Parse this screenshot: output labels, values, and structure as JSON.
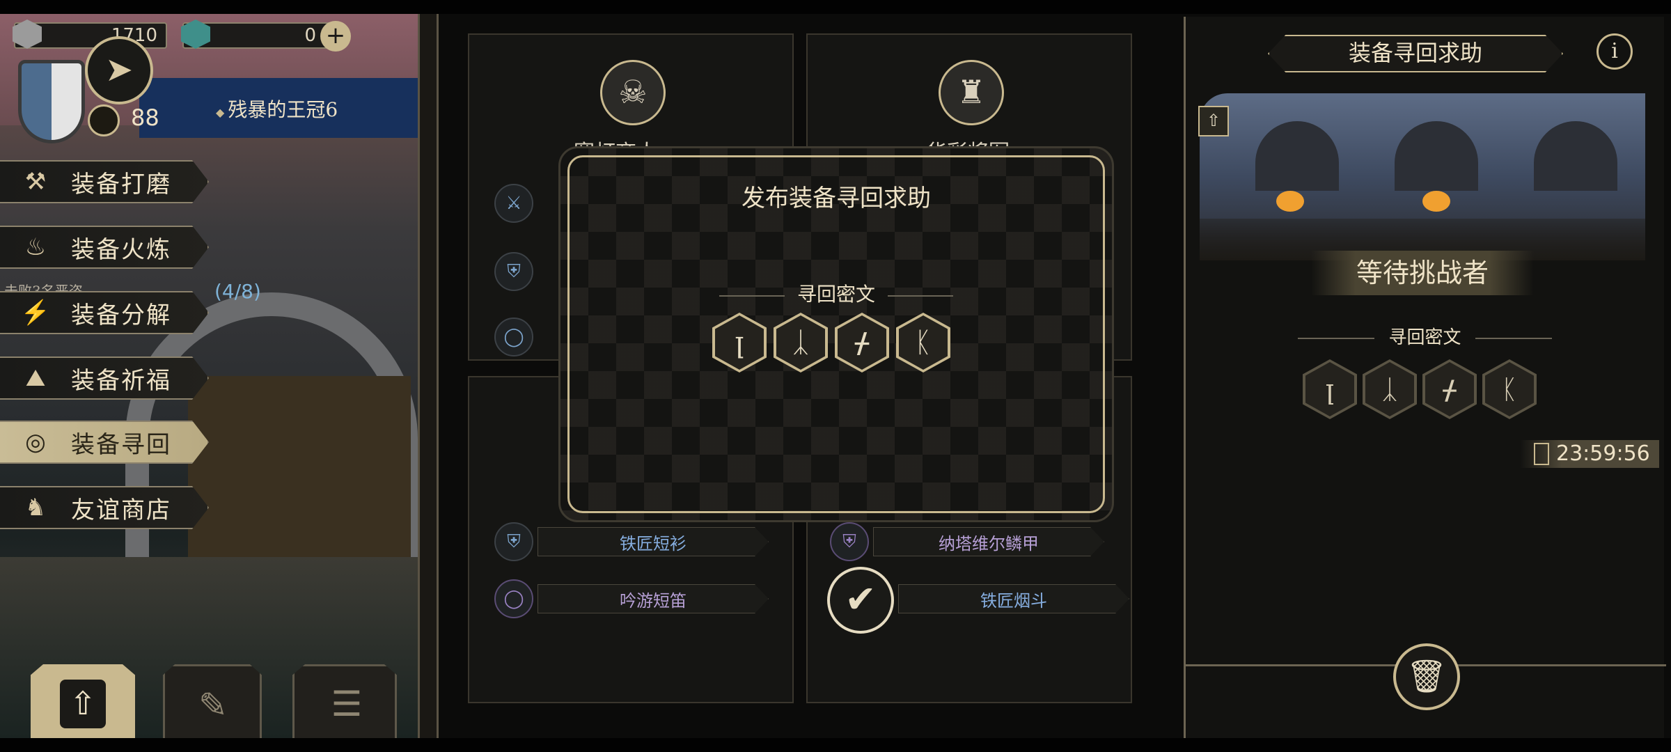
{
  "hud": {
    "resource1_value": "1710",
    "resource2_value": "0",
    "player_level": "88",
    "location_title": "残暴的王冠6",
    "quest_progress": "(4/8)",
    "quest_text": "击败3名恶盗"
  },
  "sidebar": {
    "items": [
      {
        "label": "装备打磨",
        "icon": "hammer-icon"
      },
      {
        "label": "装备火炼",
        "icon": "flame-icon"
      },
      {
        "label": "装备分解",
        "icon": "disassemble-icon"
      },
      {
        "label": "装备祈福",
        "icon": "pray-hands-icon"
      },
      {
        "label": "装备寻回",
        "icon": "target-icon",
        "active": true
      },
      {
        "label": "友谊商店",
        "icon": "fox-icon"
      }
    ]
  },
  "cards": {
    "card1_name": "寒灯商人",
    "card2_name": "华彩将军",
    "items": {
      "card3_item1": "铁匠短衫",
      "card3_item2": "吟游短笛",
      "card4_item1": "纳塔维尔鳞甲",
      "card4_item2": "铁匠烟斗"
    }
  },
  "modal": {
    "title": "发布装备寻回求助",
    "section_label": "寻回密文",
    "runes": [
      "rune-1-icon",
      "rune-2-icon",
      "rune-3-icon",
      "rune-4-icon"
    ]
  },
  "right_panel": {
    "header_title": "装备寻回求助",
    "status_title": "等待挑战者",
    "section_label": "寻回密文",
    "timer": "23:59:56"
  },
  "colors": {
    "accent_gold": "#c9b98f",
    "item_blue": "#86aee0",
    "item_purple": "#b7a0d6"
  }
}
